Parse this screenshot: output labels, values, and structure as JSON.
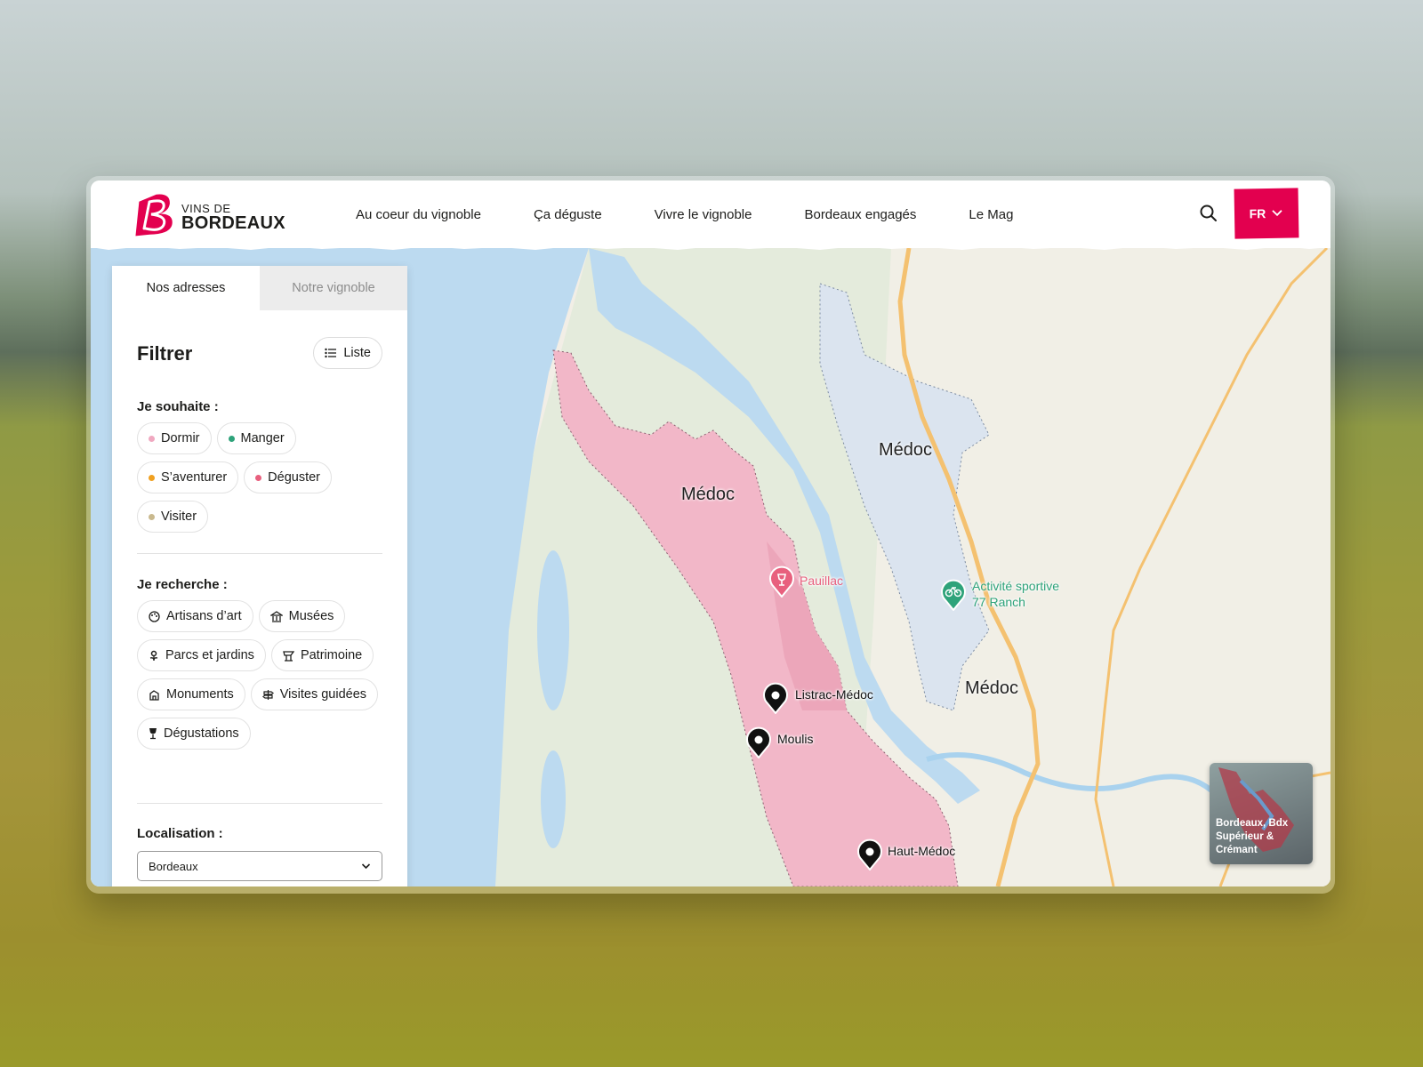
{
  "brand": {
    "small": "VINS DE",
    "big": "BORDEAUX",
    "color": "#e3004f"
  },
  "nav": [
    "Au coeur du vignoble",
    "Ça déguste",
    "Vivre le vignoble",
    "Bordeaux engagés",
    "Le Mag"
  ],
  "header": {
    "search_icon": "search-icon",
    "lang": "FR"
  },
  "panel": {
    "tabs": [
      {
        "label": "Nos adresses",
        "active": true
      },
      {
        "label": "Notre vignoble",
        "active": false
      }
    ],
    "filter_title": "Filtrer",
    "list_button": "Liste",
    "wish": {
      "title": "Je souhaite :",
      "chips": [
        {
          "label": "Dormir",
          "color": "#f0a8c0"
        },
        {
          "label": "Manger",
          "color": "#2ea37a"
        },
        {
          "label": "S’aventurer",
          "color": "#f0a020"
        },
        {
          "label": "Déguster",
          "color": "#e8607e"
        },
        {
          "label": "Visiter",
          "color": "#c9b98e"
        }
      ]
    },
    "search": {
      "title": "Je recherche :",
      "chips": [
        {
          "label": "Artisans d’art",
          "icon": "palette-icon"
        },
        {
          "label": "Musées",
          "icon": "museum-icon"
        },
        {
          "label": "Parcs et jardins",
          "icon": "flower-icon"
        },
        {
          "label": "Patrimoine",
          "icon": "heritage-icon"
        },
        {
          "label": "Monuments",
          "icon": "monument-icon"
        },
        {
          "label": "Visites guidées",
          "icon": "signpost-icon"
        },
        {
          "label": "Dégustations",
          "icon": "wine-glass-icon"
        }
      ]
    },
    "location": {
      "title": "Localisation :",
      "value": "Bordeaux"
    }
  },
  "map": {
    "region_labels": [
      "Médoc",
      "Médoc",
      "Médoc"
    ],
    "pois": {
      "pauillac": {
        "label": "Pauillac",
        "color": "#e8607e"
      },
      "ranch": {
        "label_line1": "Activité sportive",
        "label_line2": "77 Ranch",
        "color": "#2ea37a"
      },
      "listrac": {
        "label": "Listrac-Médoc"
      },
      "moulis": {
        "label": "Moulis"
      },
      "haut_medoc": {
        "label": "Haut-Médoc"
      }
    },
    "minimap": {
      "label": "Bordeaux, Bdx Supérieur & Crémant"
    }
  }
}
